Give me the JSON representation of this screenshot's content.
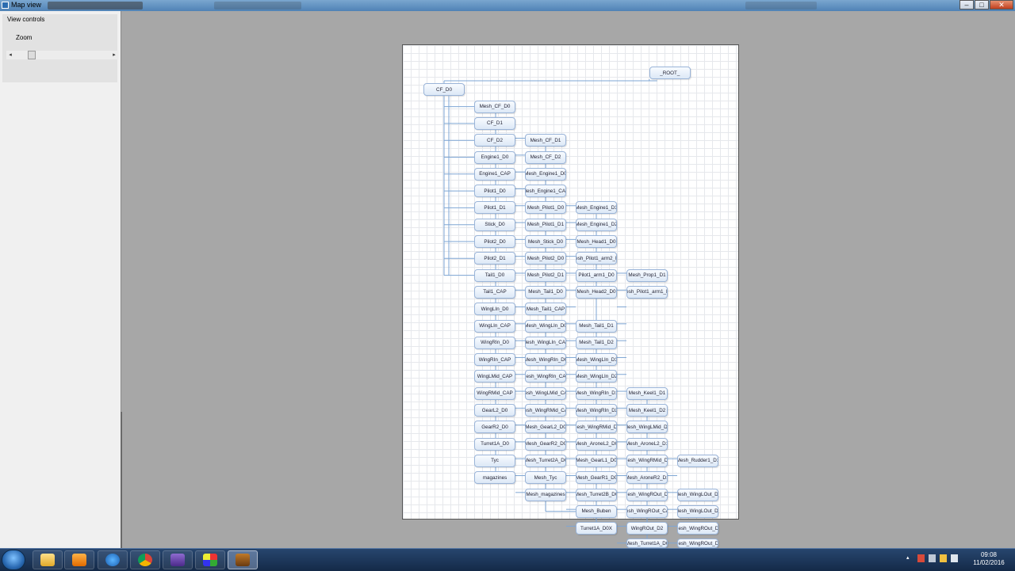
{
  "window": {
    "title": "Map view",
    "buttons": {
      "minimize": "–",
      "maximize": "□",
      "close": "✕"
    }
  },
  "left_panel": {
    "group_title": "View controls",
    "zoom_label": "Zoom",
    "zoom_level": 0.15
  },
  "map": {
    "nodes": [
      {
        "id": "root",
        "label": "_ROOT_"
      },
      {
        "id": "cf_d0",
        "label": "CF_D0"
      },
      {
        "id": "mesh_cf_d0",
        "label": "Mesh_CF_D0"
      },
      {
        "id": "cf_d1",
        "label": "CF_D1"
      },
      {
        "id": "cf_d2",
        "label": "CF_D2"
      },
      {
        "id": "engine1_d0",
        "label": "Engine1_D0"
      },
      {
        "id": "engine1_cap",
        "label": "Engine1_CAP"
      },
      {
        "id": "pilot1_d0",
        "label": "Pilot1_D0"
      },
      {
        "id": "pilot1_d1",
        "label": "Pilot1_D1"
      },
      {
        "id": "stick_d0",
        "label": "Stick_D0"
      },
      {
        "id": "pilot2_d0",
        "label": "Pilot2_D0"
      },
      {
        "id": "pilot2_d1",
        "label": "Pilot2_D1"
      },
      {
        "id": "tail1_d0",
        "label": "Tail1_D0"
      },
      {
        "id": "tail1_cap",
        "label": "Tail1_CAP"
      },
      {
        "id": "winglin_d0",
        "label": "WingLIn_D0"
      },
      {
        "id": "winglin_cap",
        "label": "WingLIn_CAP"
      },
      {
        "id": "wingrin_d0",
        "label": "WingRIn_D0"
      },
      {
        "id": "wingrin_cap",
        "label": "WingRIn_CAP"
      },
      {
        "id": "winglmid_cap",
        "label": "WingLMid_CAP"
      },
      {
        "id": "wingrmid_cap",
        "label": "WingRMid_CAP"
      },
      {
        "id": "gearl2_d0",
        "label": "GearL2_D0"
      },
      {
        "id": "gearr2_d0",
        "label": "GearR2_D0"
      },
      {
        "id": "turret1a_d0",
        "label": "Turret1A_D0"
      },
      {
        "id": "tyc",
        "label": "Tyc"
      },
      {
        "id": "magazines",
        "label": "magazines"
      },
      {
        "id": "mesh_cf_d1",
        "label": "Mesh_CF_D1"
      },
      {
        "id": "mesh_cf_d2",
        "label": "Mesh_CF_D2"
      },
      {
        "id": "mesh_engine1_d0",
        "label": "Mesh_Engine1_D0"
      },
      {
        "id": "mesh_engine1_cap",
        "label": "Mesh_Engine1_CAP"
      },
      {
        "id": "mesh_pilot1_d0",
        "label": "Mesh_Pilot1_D0"
      },
      {
        "id": "mesh_pilot1_d1",
        "label": "Mesh_Pilot1_D1"
      },
      {
        "id": "mesh_stick_d0",
        "label": "Mesh_Stick_D0"
      },
      {
        "id": "mesh_pilot2_d0",
        "label": "Mesh_Pilot2_D0"
      },
      {
        "id": "mesh_pilot2_d1",
        "label": "Mesh_Pilot2_D1"
      },
      {
        "id": "mesh_tail1_d0",
        "label": "Mesh_Tail1_D0"
      },
      {
        "id": "mesh_tail1_cap",
        "label": "Mesh_Tail1_CAP"
      },
      {
        "id": "mesh_winglin_d0",
        "label": "Mesh_WingLIn_D0"
      },
      {
        "id": "mesh_winglin_cap",
        "label": "Mesh_WingLIn_CAP"
      },
      {
        "id": "mesh_wingrin_d0",
        "label": "Mesh_WingRIn_D0"
      },
      {
        "id": "mesh_wingrin_cap",
        "label": "Mesh_WingRIn_CAP"
      },
      {
        "id": "mesh_winglmid_cap",
        "label": "Mesh_WingLMid_CAP"
      },
      {
        "id": "mesh_wingrmid_cap",
        "label": "Mesh_WingRMid_CAP"
      },
      {
        "id": "mesh_gearl2_d0",
        "label": "Mesh_GearL2_D0"
      },
      {
        "id": "mesh_gearr2_d0",
        "label": "Mesh_GearR2_D0"
      },
      {
        "id": "mesh_turret2a_d0",
        "label": "Mesh_Turret2A_D0"
      },
      {
        "id": "mesh_tyc",
        "label": "Mesh_Tyc"
      },
      {
        "id": "mesh_magazines",
        "label": "Mesh_magazines"
      },
      {
        "id": "mesh_engine1_d1",
        "label": "Mesh_Engine1_D1"
      },
      {
        "id": "mesh_engine1_d2",
        "label": "Mesh_Engine1_D2"
      },
      {
        "id": "mesh_head1_d0",
        "label": "Mesh_Head1_D0"
      },
      {
        "id": "mesh_pilot1_arm2_d0",
        "label": "Mesh_Pilot1_arm2_D0"
      },
      {
        "id": "pilot1_arm1_d0",
        "label": "Pilot1_arm1_D0"
      },
      {
        "id": "mesh_head2_d0",
        "label": "Mesh_Head2_D0"
      },
      {
        "id": "mesh_tail1_d1",
        "label": "Mesh_Tail1_D1"
      },
      {
        "id": "mesh_tail1_d2",
        "label": "Mesh_Tail1_D2"
      },
      {
        "id": "mesh_winglin_d1",
        "label": "Mesh_WingLIn_D1"
      },
      {
        "id": "mesh_winglin_d2",
        "label": "Mesh_WingLIn_D2"
      },
      {
        "id": "mesh_wingrin_d1",
        "label": "Mesh_WingRIn_D1"
      },
      {
        "id": "mesh_wingrin_d2",
        "label": "Mesh_WingRIn_D2"
      },
      {
        "id": "mesh_wingrmid_d0",
        "label": "Mesh_WingRMid_D0"
      },
      {
        "id": "mesh_aronel2_d0",
        "label": "Mesh_AroneL2_D0"
      },
      {
        "id": "mesh_gearl1_d0",
        "label": "Mesh_GearL1_D0"
      },
      {
        "id": "mesh_gearr1_d0",
        "label": "Mesh_GearR1_D0"
      },
      {
        "id": "mesh_turret2b_d0",
        "label": "Mesh_Turret2B_D0"
      },
      {
        "id": "mesh_buben",
        "label": "Mesh_Buben"
      },
      {
        "id": "turret1a_d0x",
        "label": "Turret1A_D0X"
      },
      {
        "id": "mesh_prop1_d1",
        "label": "Mesh_Prop1_D1"
      },
      {
        "id": "mesh_pilot1_arm1_d0",
        "label": "Mesh_Pilot1_arm1_D0"
      },
      {
        "id": "mesh_keel1_d1",
        "label": "Mesh_Keel1_D1"
      },
      {
        "id": "mesh_keel1_d2",
        "label": "Mesh_Keel1_D2"
      },
      {
        "id": "mesh_winglmid_d1",
        "label": "Mesh_WingLMid_D1"
      },
      {
        "id": "mesh_aronel2_d1",
        "label": "Mesh_AroneL2_D1"
      },
      {
        "id": "mesh_wingrmid_d1",
        "label": "Mesh_WingRMid_D1"
      },
      {
        "id": "mesh_aroner2_d1",
        "label": "Mesh_AroneR2_D1"
      },
      {
        "id": "mesh_wingrout_d0",
        "label": "Mesh_WingROut_D0"
      },
      {
        "id": "mesh_wingrout_cap",
        "label": "Mesh_WingROut_CAP"
      },
      {
        "id": "wingrout_d2",
        "label": "WingROut_D2"
      },
      {
        "id": "mesh_turret1a_d0",
        "label": "Mesh_Turret1A_D0"
      },
      {
        "id": "mesh_rudder1_d1",
        "label": "Mesh_Rudder1_D1"
      },
      {
        "id": "mesh_winglout_d1",
        "label": "Mesh_WingLOut_D1"
      },
      {
        "id": "mesh_winglout_d2",
        "label": "Mesh_WingLOut_D2"
      },
      {
        "id": "mesh_wingrout_d1",
        "label": "Mesh_WingROut_D1"
      },
      {
        "id": "mesh_wingrout_d2",
        "label": "Mesh_WingROut_D2"
      }
    ]
  },
  "taskbar": {
    "apps": [
      "file-explorer",
      "media-player",
      "internet-explorer",
      "chrome",
      "visual-studio",
      "paint-app",
      "map-editor-app"
    ],
    "clock": {
      "time": "09:08",
      "date": "11/02/2016"
    }
  },
  "colors": {
    "node_border": "#9ab4d8",
    "connector": "#7ea6d4",
    "desktop": "#a7a7a7"
  }
}
